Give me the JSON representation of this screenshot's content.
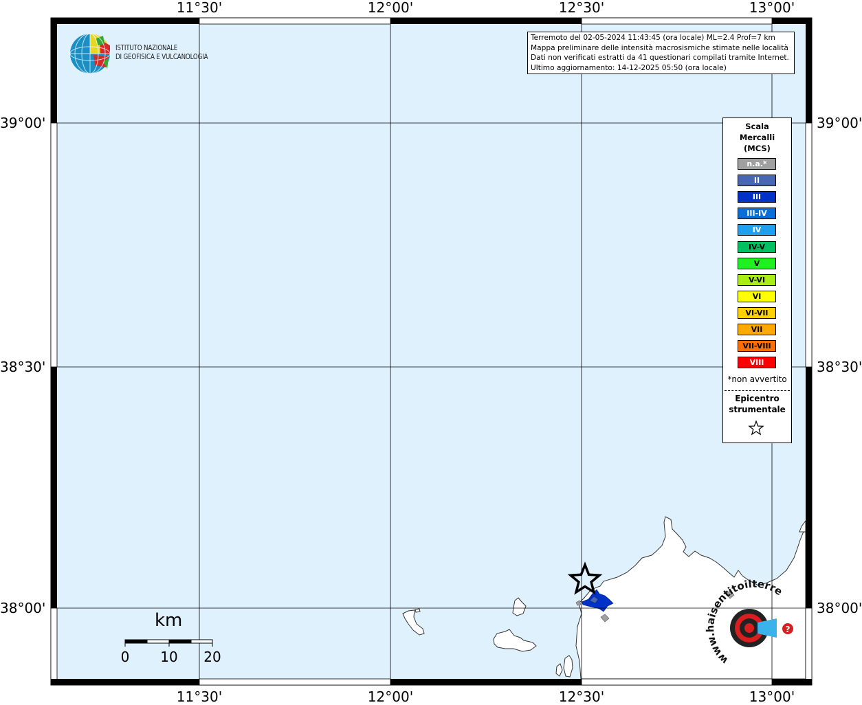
{
  "map": {
    "lon_ticks": [
      "11°30'",
      "12°00'",
      "12°30'",
      "13°00'"
    ],
    "lat_ticks": [
      "39°00'",
      "38°30'",
      "38°00'"
    ],
    "colors": {
      "sea": "#e0f1fe",
      "land": "#ffffff",
      "grid": "#000000",
      "frame": "#000000"
    }
  },
  "logo": {
    "line1": "ISTITUTO NAZIONALE",
    "line2": "DI GEOFISICA E VULCANOLOGIA",
    "icon": "ingv-globe-logo"
  },
  "info": {
    "line1": "Terremoto del 02-05-2024 11:43:45 (ora locale) ML=2.4 Prof=7 km",
    "line2": "Mappa preliminare delle intensità macrosismiche stimate nelle località",
    "line3": "Dati non verificati estratti da 41 questionari compilati tramite Internet.",
    "line4": "Ultimo aggiornamento: 14-12-2025 05:50 (ora locale)"
  },
  "legend": {
    "title1": "Scala",
    "title2": "Mercalli",
    "title3": "(MCS)",
    "items": [
      {
        "label": "n.a.*",
        "color": "#a0a0a0"
      },
      {
        "label": "II",
        "color": "#4766b3"
      },
      {
        "label": "III",
        "color": "#0032c8"
      },
      {
        "label": "III-IV",
        "color": "#0a6ed8"
      },
      {
        "label": "IV",
        "color": "#1ea0ee"
      },
      {
        "label": "IV-V",
        "color": "#00c060"
      },
      {
        "label": "V",
        "color": "#20f020"
      },
      {
        "label": "V-VI",
        "color": "#a8ee14"
      },
      {
        "label": "VI",
        "color": "#ffff00"
      },
      {
        "label": "VI-VII",
        "color": "#ffd000"
      },
      {
        "label": "VII",
        "color": "#ffa800"
      },
      {
        "label": "VII-VIII",
        "color": "#ff6e00"
      },
      {
        "label": "VIII",
        "color": "#ff0000"
      }
    ],
    "note": "*non avvertito",
    "epi1": "Epicentro",
    "epi2": "strumentale",
    "epi_icon": "star-icon"
  },
  "scale_bar": {
    "unit": "km",
    "labels": [
      "0",
      "10",
      "20"
    ]
  },
  "hst_logo": {
    "text": "www.haisentitoilterremoto.it",
    "icon": "haisentito-target-logo"
  }
}
